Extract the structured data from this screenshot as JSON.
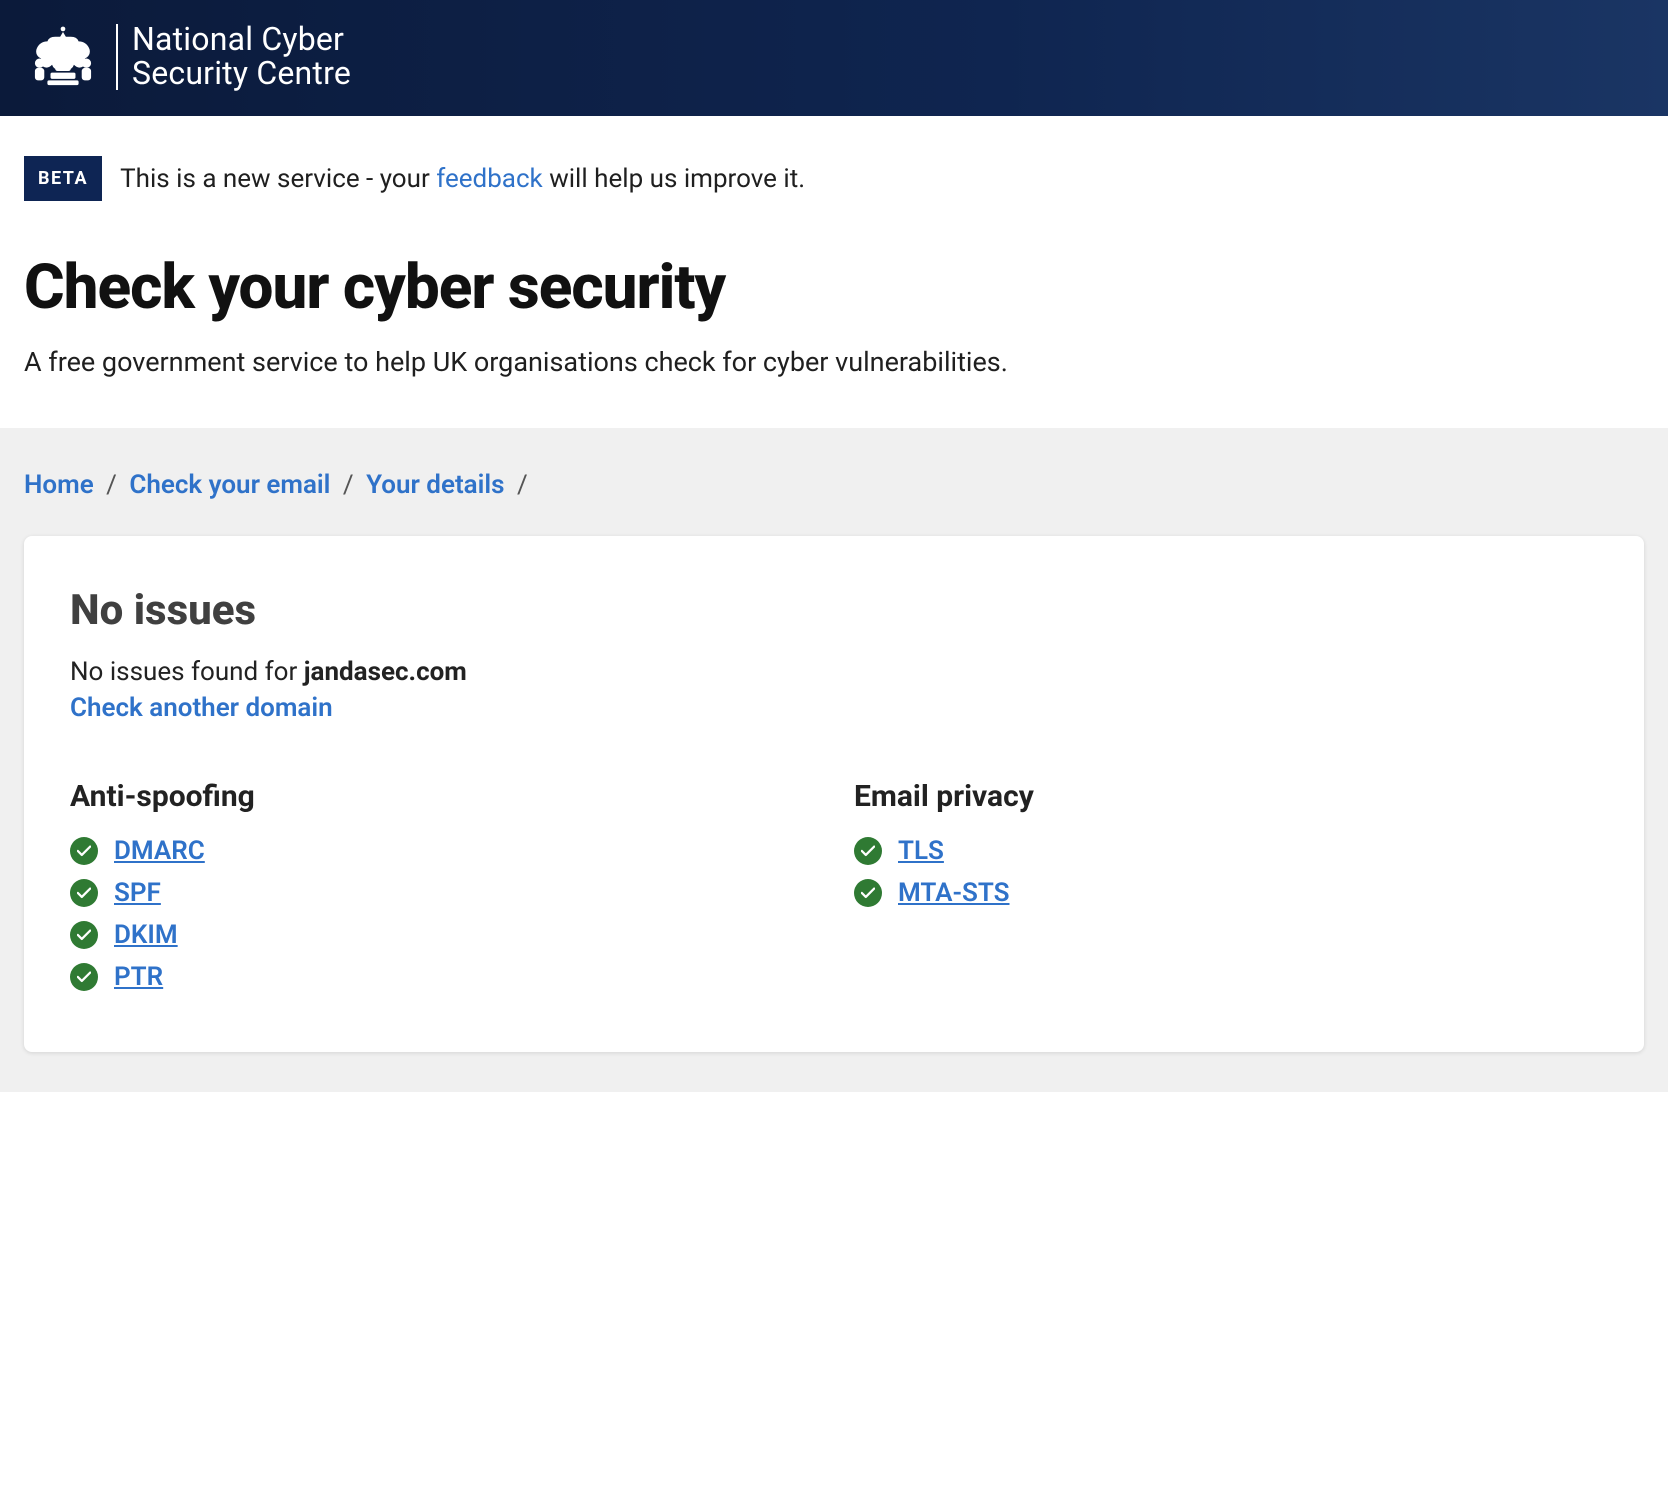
{
  "header": {
    "org_line1": "National Cyber",
    "org_line2": "Security Centre"
  },
  "notice": {
    "badge": "BETA",
    "text_before": "This is a new service - your ",
    "feedback_label": "feedback",
    "text_after": " will help us improve it."
  },
  "page": {
    "title": "Check your cyber security",
    "subtitle": "A free government service to help UK organisations check for cyber vulnerabilities."
  },
  "breadcrumb": {
    "items": [
      {
        "label": "Home"
      },
      {
        "label": "Check your email"
      },
      {
        "label": "Your details"
      }
    ],
    "sep": "/"
  },
  "card": {
    "heading": "No issues",
    "summary_before": "No issues found for  ",
    "domain": "jandasec.com",
    "check_another": "Check another domain",
    "columns": [
      {
        "title": "Anti-spoofing",
        "items": [
          {
            "label": "DMARC",
            "status": "ok"
          },
          {
            "label": "SPF",
            "status": "ok"
          },
          {
            "label": "DKIM",
            "status": "ok"
          },
          {
            "label": "PTR",
            "status": "ok"
          }
        ]
      },
      {
        "title": "Email privacy",
        "items": [
          {
            "label": "TLS",
            "status": "ok"
          },
          {
            "label": "MTA-STS",
            "status": "ok"
          }
        ]
      }
    ]
  }
}
